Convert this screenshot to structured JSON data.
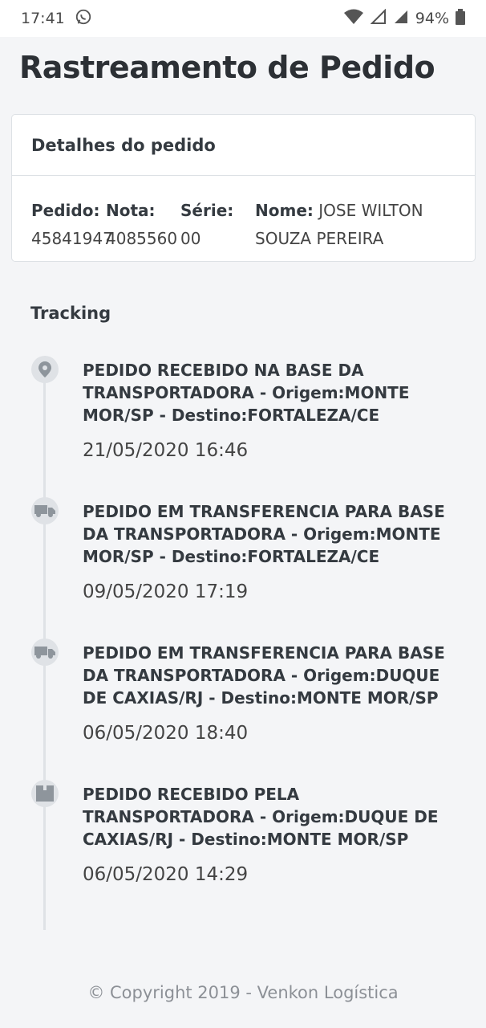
{
  "status_bar": {
    "time": "17:41",
    "battery": "94%",
    "icons": [
      "whatsapp-icon",
      "wifi-icon",
      "signal-icon",
      "signal-x-icon",
      "battery-icon"
    ]
  },
  "page": {
    "title": "Rastreamento de Pedido"
  },
  "order_card": {
    "header": "Detalhes do pedido",
    "pedido_label": "Pedido:",
    "pedido_value": "45841947",
    "nota_label": "Nota:",
    "nota_value": "4085560",
    "serie_label": "Série:",
    "serie_value": "00",
    "nome_label": "Nome:",
    "nome_value_line1": "JOSE WILTON",
    "nome_value_line2": "SOUZA PEREIRA"
  },
  "tracking": {
    "title": "Tracking",
    "events": [
      {
        "icon": "map-pin-icon",
        "description": "PEDIDO RECEBIDO NA BASE DA TRANSPORTADORA - Origem:MONTE MOR/SP - Destino:FORTALEZA/CE",
        "date": "21/05/2020 16:46"
      },
      {
        "icon": "truck-icon",
        "description": "PEDIDO EM TRANSFERENCIA PARA BASE DA TRANSPORTADORA - Origem:MONTE MOR/SP - Destino:FORTALEZA/CE",
        "date": "09/05/2020 17:19"
      },
      {
        "icon": "truck-icon",
        "description": "PEDIDO EM TRANSFERENCIA PARA BASE DA TRANSPORTADORA - Origem:DUQUE DE CAXIAS/RJ - Destino:MONTE MOR/SP",
        "date": "06/05/2020 18:40"
      },
      {
        "icon": "box-icon",
        "description": "PEDIDO RECEBIDO PELA TRANSPORTADORA - Origem:DUQUE DE CAXIAS/RJ - Destino:MONTE MOR/SP",
        "date": "06/05/2020 14:29"
      }
    ]
  },
  "footer": {
    "copyright": "© Copyright 2019 - Venkon Logística"
  },
  "colors": {
    "background": "#f4f5f7",
    "card": "#ffffff",
    "text": "#343a40",
    "timeline": "#dfe2e6",
    "icon": "#8e959c"
  }
}
